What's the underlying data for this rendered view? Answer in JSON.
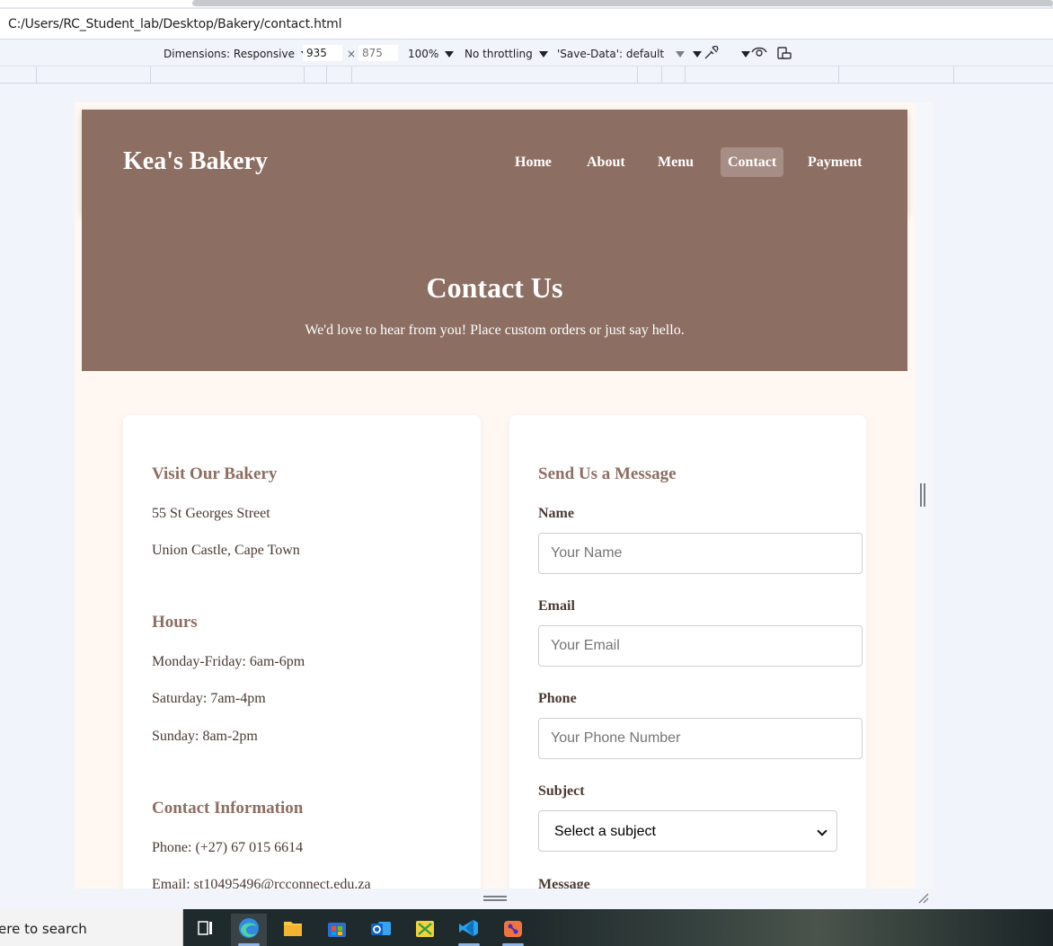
{
  "browser": {
    "address": "C:/Users/RC_Student_lab/Desktop/Bakery/contact.html",
    "device_toolbar": {
      "dimensions_label": "Dimensions: Responsive",
      "width": "935",
      "height_placeholder": "875",
      "times": "×",
      "zoom": "100%",
      "throttling": "No throttling",
      "save_data": "'Save-Data': default"
    }
  },
  "site": {
    "brand": "Kea's Bakery",
    "nav": [
      {
        "label": "Home"
      },
      {
        "label": "About"
      },
      {
        "label": "Menu"
      },
      {
        "label": "Contact"
      },
      {
        "label": "Payment"
      }
    ],
    "hero": {
      "title": "Contact Us",
      "subtitle": "We'd love to hear from you! Place custom orders or just say hello."
    },
    "info": {
      "visit_heading": "Visit Our Bakery",
      "address_line1": "55 St Georges Street",
      "address_line2": "Union Castle, Cape Town",
      "hours_heading": "Hours",
      "hours": [
        "Monday-Friday: 6am-6pm",
        "Saturday: 7am-4pm",
        "Sunday: 8am-2pm"
      ],
      "contact_heading": "Contact Information",
      "phone": "Phone: (+27) 67 015 6614",
      "email": "Email: st10495496@rcconnect.edu.za"
    },
    "form": {
      "heading": "Send Us a Message",
      "name_label": "Name",
      "name_placeholder": "Your Name",
      "email_label": "Email",
      "email_placeholder": "Your Email",
      "phone_label": "Phone",
      "phone_placeholder": "Your Phone Number",
      "subject_label": "Subject",
      "subject_value": "Select a subject",
      "message_label": "Message"
    }
  },
  "taskbar": {
    "search_text": "ere to search"
  },
  "colors": {
    "brand_brown": "#8d6e63",
    "page_bg": "#fff8f2",
    "text_dark": "#4a3a34"
  }
}
